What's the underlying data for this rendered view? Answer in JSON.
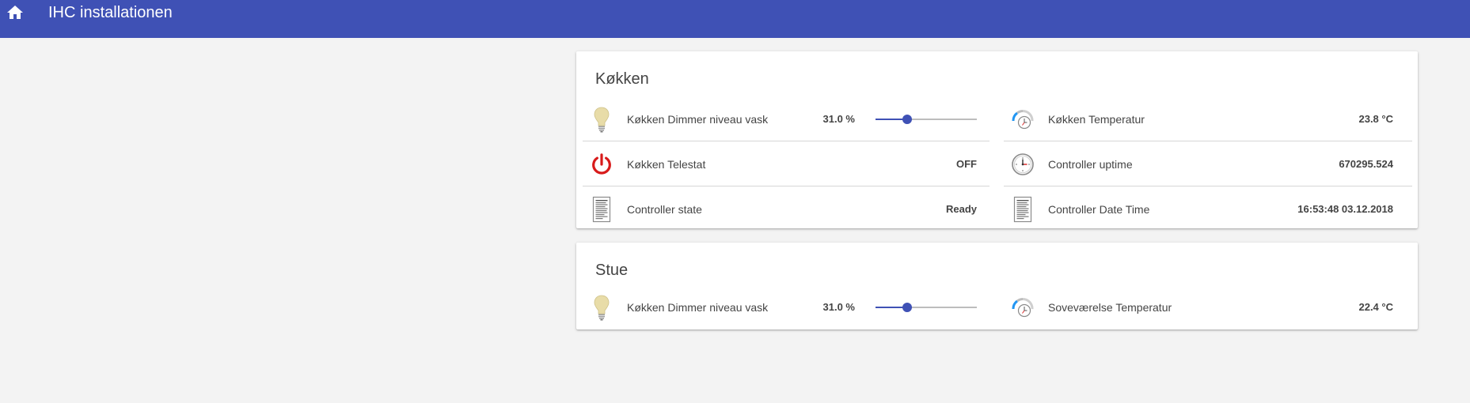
{
  "app": {
    "title": "IHC installationen",
    "home_icon": "home-icon"
  },
  "colors": {
    "appbar": "#3f51b5",
    "accent": "#3f51b5",
    "power_icon": "#d81b1b"
  },
  "cards": {
    "kokken": {
      "title": "Køkken",
      "left": [
        {
          "icon": "bulb-icon",
          "label": "Køkken Dimmer niveau vask",
          "value": "31.0 %",
          "slider_percent": 31
        },
        {
          "icon": "power-icon",
          "label": "Køkken Telestat",
          "value": "OFF"
        },
        {
          "icon": "document-icon",
          "label": "Controller state",
          "value": "Ready"
        }
      ],
      "right": [
        {
          "icon": "thermometer-gauge-icon",
          "label": "Køkken Temperatur",
          "value": "23.8 °C"
        },
        {
          "icon": "clock-icon",
          "label": "Controller uptime",
          "value": "670295.524"
        },
        {
          "icon": "document-icon",
          "label": "Controller Date Time",
          "value": "16:53:48 03.12.2018"
        }
      ]
    },
    "stue": {
      "title": "Stue",
      "left": [
        {
          "icon": "bulb-icon",
          "label": "Køkken Dimmer niveau vask",
          "value": "31.0 %",
          "slider_percent": 31
        }
      ],
      "right": [
        {
          "icon": "thermometer-gauge-icon",
          "label": "Soveværelse Temperatur",
          "value": "22.4 °C"
        }
      ]
    }
  }
}
